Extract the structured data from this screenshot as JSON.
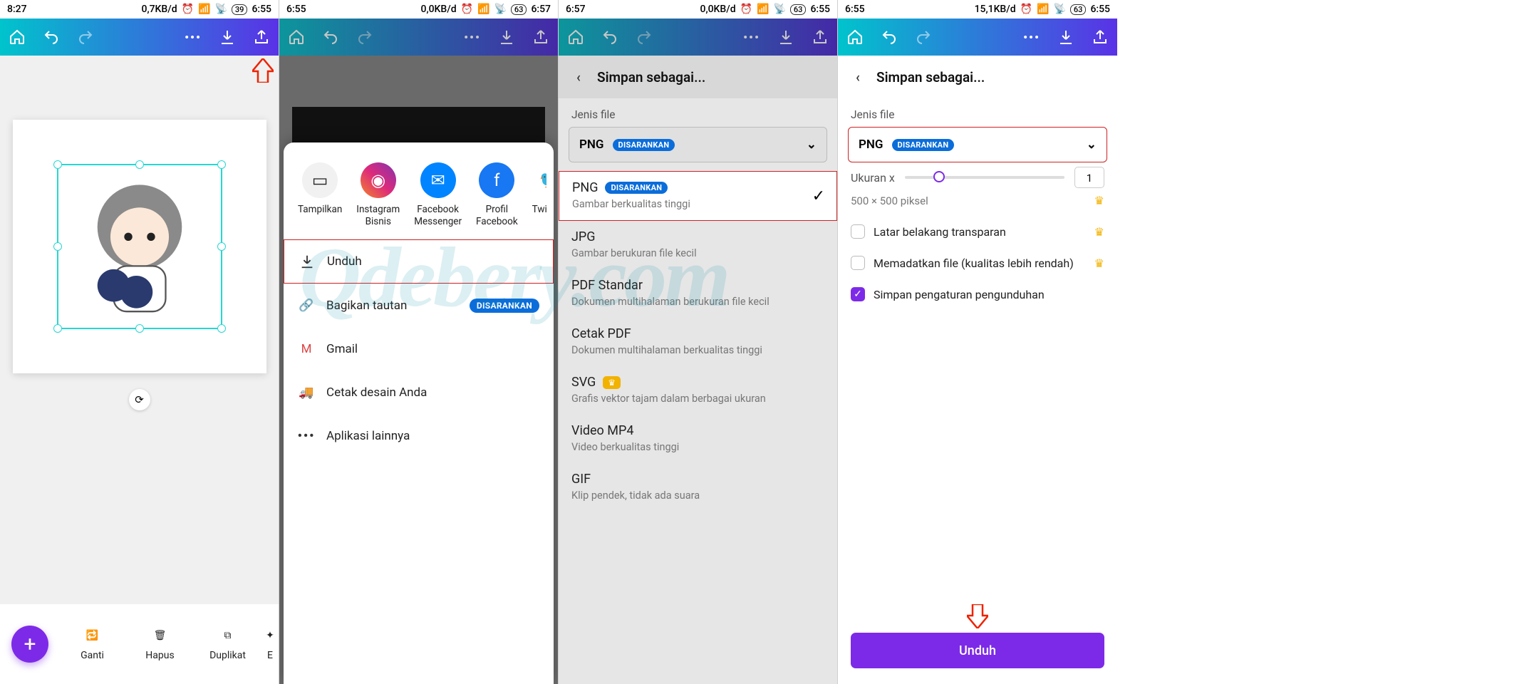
{
  "watermark": "Qdebery.com",
  "screens": [
    {
      "status": {
        "time": "8:27",
        "net": "0,7KB/d",
        "battery": "39",
        "clock2": "6:55"
      },
      "bottombar": [
        "Ganti",
        "Hapus",
        "Duplikat",
        "E"
      ]
    },
    {
      "status": {
        "time": "6:55",
        "net": "0,0KB/d",
        "battery": "63",
        "clock2": "6:57"
      },
      "share": [
        {
          "label": "Tampilkan"
        },
        {
          "label": "Instagram Bisnis"
        },
        {
          "label": "Facebook Messenger"
        },
        {
          "label": "Profil Facebook"
        },
        {
          "label": "Twitte"
        }
      ],
      "list": {
        "unduh": "Unduh",
        "bagikan": "Bagikan tautan",
        "bagikan_badge": "DISARANKAN",
        "gmail": "Gmail",
        "cetak": "Cetak desain Anda",
        "lainnya": "Aplikasi lainnya"
      }
    },
    {
      "status": {
        "time": "6:57",
        "net": "0,0KB/d",
        "battery": "63",
        "clock2": "6:55"
      },
      "header": "Simpan sebagai...",
      "section": "Jenis file",
      "dropdown": {
        "value": "PNG",
        "badge": "DISARANKAN"
      },
      "options": [
        {
          "title": "PNG",
          "badge": "DISARANKAN",
          "desc": "Gambar berkualitas tinggi",
          "selected": true
        },
        {
          "title": "JPG",
          "desc": "Gambar berukuran file kecil"
        },
        {
          "title": "PDF Standar",
          "desc": "Dokumen multihalaman berukuran file kecil"
        },
        {
          "title": "Cetak PDF",
          "desc": "Dokumen multihalaman berkualitas tinggi"
        },
        {
          "title": "SVG",
          "crown": true,
          "desc": "Grafis vektor tajam dalam berbagai ukuran"
        },
        {
          "title": "Video MP4",
          "desc": "Video berkualitas tinggi"
        },
        {
          "title": "GIF",
          "desc": "Klip pendek, tidak ada suara"
        }
      ]
    },
    {
      "status": {
        "time": "6:55",
        "net": "15,1KB/d",
        "battery": "63",
        "clock2": "6:55"
      },
      "header": "Simpan sebagai...",
      "section": "Jenis file",
      "dropdown": {
        "value": "PNG",
        "badge": "DISARANKAN"
      },
      "size": {
        "label": "Ukuran x",
        "value": "1",
        "dims": "500 × 500 piksel"
      },
      "opts": {
        "transparent": "Latar belakang transparan",
        "compress": "Memadatkan file (kualitas lebih rendah)",
        "save_settings": "Simpan pengaturan pengunduhan"
      },
      "button": "Unduh"
    }
  ]
}
